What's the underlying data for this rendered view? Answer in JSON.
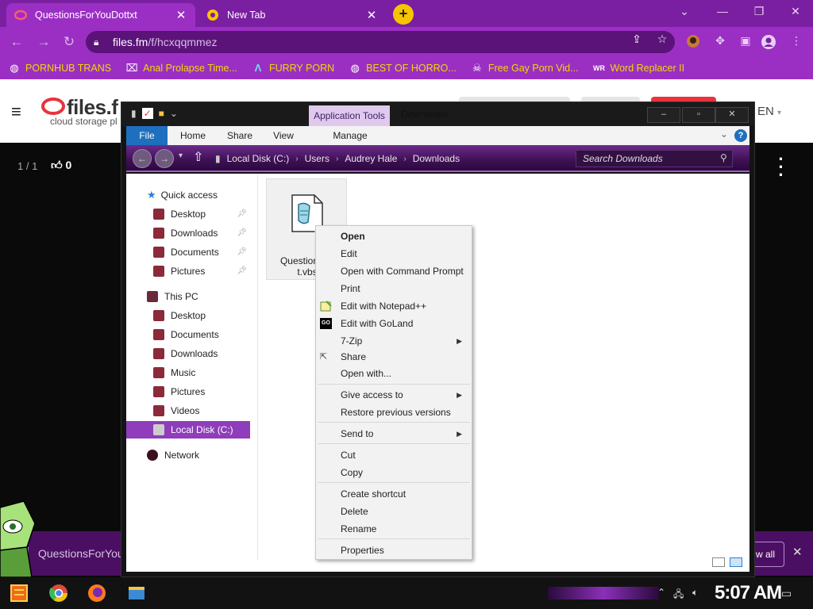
{
  "browser": {
    "tabs": [
      {
        "title": "QuestionsForYouDottxt"
      },
      {
        "title": "New Tab"
      }
    ],
    "url_host": "files.fm",
    "url_path": "/f/hcxqqmmez",
    "bookmarks": [
      {
        "label": "PORNHUB TRANS",
        "icon": "globe-icon"
      },
      {
        "label": "Anal Prolapse Time...",
        "icon": "bookmark-icon"
      },
      {
        "label": "FURRY PORN",
        "icon": "lambda-icon"
      },
      {
        "label": "BEST OF HORRO...",
        "icon": "globe-icon"
      },
      {
        "label": "Free Gay Porn Vid...",
        "icon": "skull-icon"
      },
      {
        "label": "Word Replacer II",
        "icon": "wr-icon"
      }
    ],
    "colors": {
      "tab_strip": "#7a1fa2",
      "toolbar": "#9b2fc4",
      "bookmark_text": "#f0d800",
      "new_tab_button": "#f7c400"
    }
  },
  "site": {
    "logo": "files.f",
    "tagline": "cloud storage pl",
    "lang": "EN",
    "pager": "1 / 1",
    "likes": "0",
    "bottom_file_name": "QuestionsForYou",
    "view_all": "w all"
  },
  "explorer": {
    "contextual_tab": "Application Tools",
    "title": "Downloads",
    "ribbon_tabs": [
      "File",
      "Home",
      "Share",
      "View",
      "Manage"
    ],
    "breadcrumb": [
      "Local Disk (C:)",
      "Users",
      "Audrey Hale",
      "Downloads"
    ],
    "search_placeholder": "Search Downloads",
    "quick_access": {
      "label": "Quick access",
      "items": [
        "Desktop",
        "Downloads",
        "Documents",
        "Pictures"
      ]
    },
    "this_pc": {
      "label": "This PC",
      "items": [
        "Desktop",
        "Documents",
        "Downloads",
        "Music",
        "Pictures",
        "Videos",
        "Local Disk (C:)"
      ]
    },
    "network": "Network",
    "file": {
      "name_line1": "QuestionsFo",
      "name_line2": "t.vbs"
    }
  },
  "context_menu": {
    "items": [
      {
        "label": "Open",
        "bold": true
      },
      {
        "label": "Edit"
      },
      {
        "label": "Open with Command Prompt"
      },
      {
        "label": "Print"
      },
      {
        "label": "Edit with Notepad++",
        "icon": "notepad-plus-plus-icon"
      },
      {
        "label": "Edit with GoLand",
        "icon": "goland-icon"
      },
      {
        "label": "7-Zip",
        "submenu": true
      },
      {
        "label": "Share",
        "icon": "share-icon"
      },
      {
        "label": "Open with..."
      },
      {
        "label": "Give access to",
        "submenu": true
      },
      {
        "label": "Restore previous versions"
      },
      {
        "label": "Send to",
        "submenu": true
      },
      {
        "label": "Cut"
      },
      {
        "label": "Copy"
      },
      {
        "label": "Create shortcut"
      },
      {
        "label": "Delete"
      },
      {
        "label": "Rename"
      },
      {
        "label": "Properties"
      }
    ]
  },
  "taskbar": {
    "clock": "5:07 AM"
  }
}
